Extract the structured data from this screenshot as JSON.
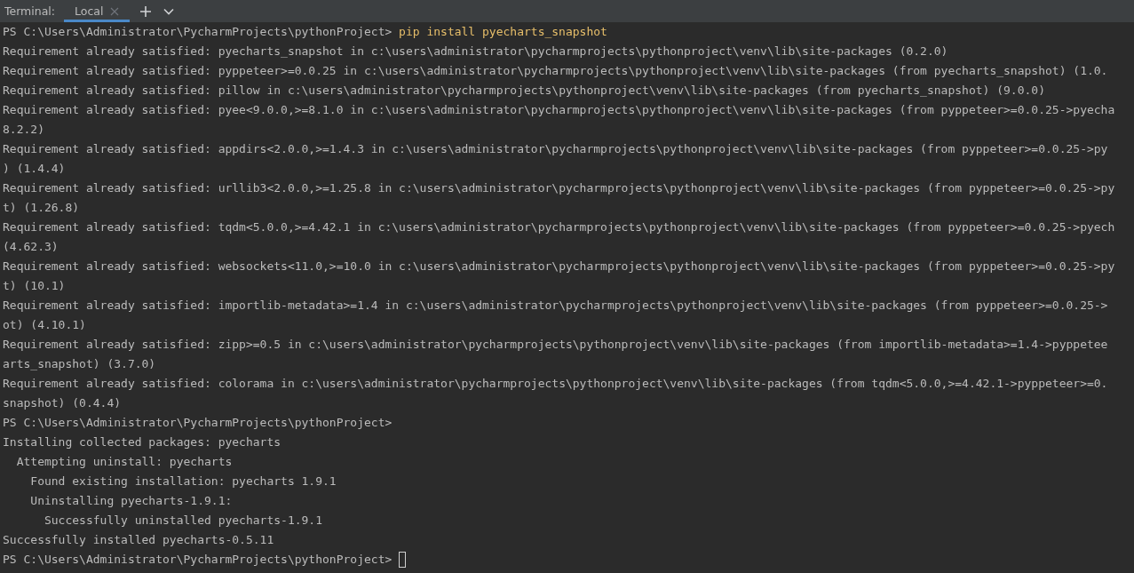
{
  "header": {
    "label": "Terminal:",
    "tabs": [
      {
        "label": "Local",
        "selected": true
      }
    ]
  },
  "lines": [
    {
      "kind": "prompt",
      "prompt": "PS C:\\Users\\Administrator\\PycharmProjects\\pythonProject>",
      "command": "pip install pyecharts_snapshot",
      "cursor": false
    },
    {
      "kind": "output",
      "text": "Requirement already satisfied: pyecharts_snapshot in c:\\users\\administrator\\pycharmprojects\\pythonproject\\venv\\lib\\site-packages (0.2.0)"
    },
    {
      "kind": "output",
      "text": "Requirement already satisfied: pyppeteer>=0.0.25 in c:\\users\\administrator\\pycharmprojects\\pythonproject\\venv\\lib\\site-packages (from pyecharts_snapshot) (1.0."
    },
    {
      "kind": "output",
      "text": "Requirement already satisfied: pillow in c:\\users\\administrator\\pycharmprojects\\pythonproject\\venv\\lib\\site-packages (from pyecharts_snapshot) (9.0.0)"
    },
    {
      "kind": "output",
      "text": "Requirement already satisfied: pyee<9.0.0,>=8.1.0 in c:\\users\\administrator\\pycharmprojects\\pythonproject\\venv\\lib\\site-packages (from pyppeteer>=0.0.25->pyecha"
    },
    {
      "kind": "output",
      "text": "8.2.2)"
    },
    {
      "kind": "output",
      "text": "Requirement already satisfied: appdirs<2.0.0,>=1.4.3 in c:\\users\\administrator\\pycharmprojects\\pythonproject\\venv\\lib\\site-packages (from pyppeteer>=0.0.25->py"
    },
    {
      "kind": "output",
      "text": ") (1.4.4)"
    },
    {
      "kind": "output",
      "text": "Requirement already satisfied: urllib3<2.0.0,>=1.25.8 in c:\\users\\administrator\\pycharmprojects\\pythonproject\\venv\\lib\\site-packages (from pyppeteer>=0.0.25->py"
    },
    {
      "kind": "output",
      "text": "t) (1.26.8)"
    },
    {
      "kind": "output",
      "text": "Requirement already satisfied: tqdm<5.0.0,>=4.42.1 in c:\\users\\administrator\\pycharmprojects\\pythonproject\\venv\\lib\\site-packages (from pyppeteer>=0.0.25->pyech"
    },
    {
      "kind": "output",
      "text": "(4.62.3)"
    },
    {
      "kind": "output",
      "text": "Requirement already satisfied: websockets<11.0,>=10.0 in c:\\users\\administrator\\pycharmprojects\\pythonproject\\venv\\lib\\site-packages (from pyppeteer>=0.0.25->py"
    },
    {
      "kind": "output",
      "text": "t) (10.1)"
    },
    {
      "kind": "output",
      "text": "Requirement already satisfied: importlib-metadata>=1.4 in c:\\users\\administrator\\pycharmprojects\\pythonproject\\venv\\lib\\site-packages (from pyppeteer>=0.0.25->"
    },
    {
      "kind": "output",
      "text": "ot) (4.10.1)"
    },
    {
      "kind": "output",
      "text": "Requirement already satisfied: zipp>=0.5 in c:\\users\\administrator\\pycharmprojects\\pythonproject\\venv\\lib\\site-packages (from importlib-metadata>=1.4->pyppetee"
    },
    {
      "kind": "output",
      "text": "arts_snapshot) (3.7.0)"
    },
    {
      "kind": "output",
      "text": "Requirement already satisfied: colorama in c:\\users\\administrator\\pycharmprojects\\pythonproject\\venv\\lib\\site-packages (from tqdm<5.0.0,>=4.42.1->pyppeteer>=0."
    },
    {
      "kind": "output",
      "text": "snapshot) (0.4.4)"
    },
    {
      "kind": "prompt",
      "prompt": "PS C:\\Users\\Administrator\\PycharmProjects\\pythonProject>",
      "cursor": false
    },
    {
      "kind": "output",
      "text": "Installing collected packages: pyecharts"
    },
    {
      "kind": "output",
      "text": "  Attempting uninstall: pyecharts"
    },
    {
      "kind": "output",
      "text": "    Found existing installation: pyecharts 1.9.1"
    },
    {
      "kind": "output",
      "text": "    Uninstalling pyecharts-1.9.1:"
    },
    {
      "kind": "output",
      "text": "      Successfully uninstalled pyecharts-1.9.1"
    },
    {
      "kind": "output",
      "text": "Successfully installed pyecharts-0.5.11"
    },
    {
      "kind": "prompt",
      "prompt": "PS C:\\Users\\Administrator\\PycharmProjects\\pythonProject>",
      "cursor": true
    }
  ]
}
